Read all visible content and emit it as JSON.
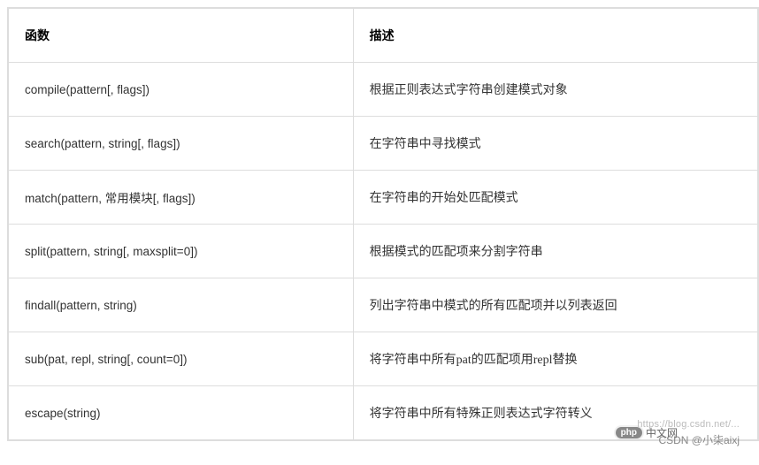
{
  "headers": {
    "col1": "函数",
    "col2": "描述"
  },
  "rows": [
    {
      "fn": "compile(pattern[, flags])",
      "desc": "根据正则表达式字符串创建模式对象"
    },
    {
      "fn": "search(pattern, string[, flags])",
      "desc": "在字符串中寻找模式"
    },
    {
      "fn": "match(pattern, 常用模块[, flags])",
      "desc": "在字符串的开始处匹配模式"
    },
    {
      "fn": "split(pattern, string[, maxsplit=0])",
      "desc": "根据模式的匹配项来分割字符串"
    },
    {
      "fn": "findall(pattern, string)",
      "desc": "列出字符串中模式的所有匹配项并以列表返回"
    },
    {
      "fn": "sub(pat, repl, string[, count=0])",
      "desc": "将字符串中所有pat的匹配项用repl替换"
    },
    {
      "fn": "escape(string)",
      "desc": "将字符串中所有特殊正则表达式字符转义"
    }
  ],
  "watermark": "https://blog.csdn.net/...",
  "badge": {
    "pill": "php",
    "suffix": "中文网"
  },
  "credit": "CSDN @小柒aixj"
}
